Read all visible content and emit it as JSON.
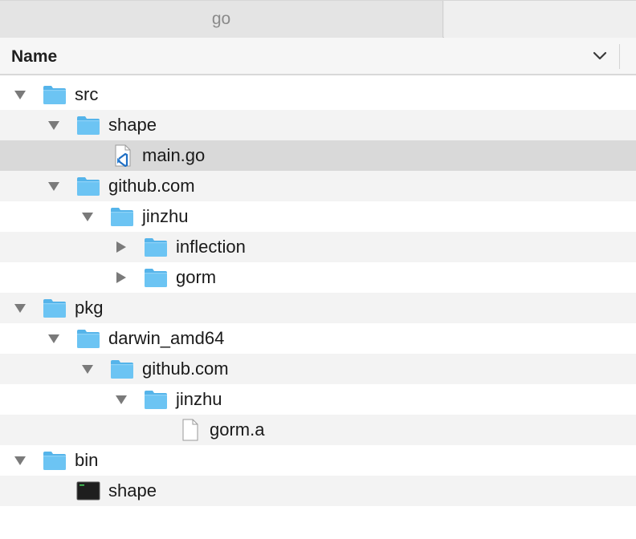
{
  "tabs": [
    {
      "label": "go",
      "active": true
    },
    {
      "label": "",
      "active": false
    }
  ],
  "column_header": {
    "name_label": "Name",
    "sort_icon": "chevron-down-icon"
  },
  "colors": {
    "folder": "#6cc4f3",
    "folder_tab": "#55b4ea",
    "selection": "#d9d9d9",
    "stripe": "#f3f3f3",
    "disclosure": "#7a7a7a"
  },
  "tree": [
    {
      "label": "src",
      "depth": 0,
      "kind": "folder",
      "expanded": true
    },
    {
      "label": "shape",
      "depth": 1,
      "kind": "folder",
      "expanded": true
    },
    {
      "label": "main.go",
      "depth": 2,
      "kind": "go-file",
      "selected": true
    },
    {
      "label": "github.com",
      "depth": 1,
      "kind": "folder",
      "expanded": true
    },
    {
      "label": "jinzhu",
      "depth": 2,
      "kind": "folder",
      "expanded": true
    },
    {
      "label": "inflection",
      "depth": 3,
      "kind": "folder",
      "expanded": false
    },
    {
      "label": "gorm",
      "depth": 3,
      "kind": "folder",
      "expanded": false
    },
    {
      "label": "pkg",
      "depth": 0,
      "kind": "folder",
      "expanded": true
    },
    {
      "label": "darwin_amd64",
      "depth": 1,
      "kind": "folder",
      "expanded": true
    },
    {
      "label": "github.com",
      "depth": 2,
      "kind": "folder",
      "expanded": true
    },
    {
      "label": "jinzhu",
      "depth": 3,
      "kind": "folder",
      "expanded": true
    },
    {
      "label": "gorm.a",
      "depth": 4,
      "kind": "file"
    },
    {
      "label": "bin",
      "depth": 0,
      "kind": "folder",
      "expanded": true
    },
    {
      "label": "shape",
      "depth": 1,
      "kind": "executable"
    }
  ]
}
